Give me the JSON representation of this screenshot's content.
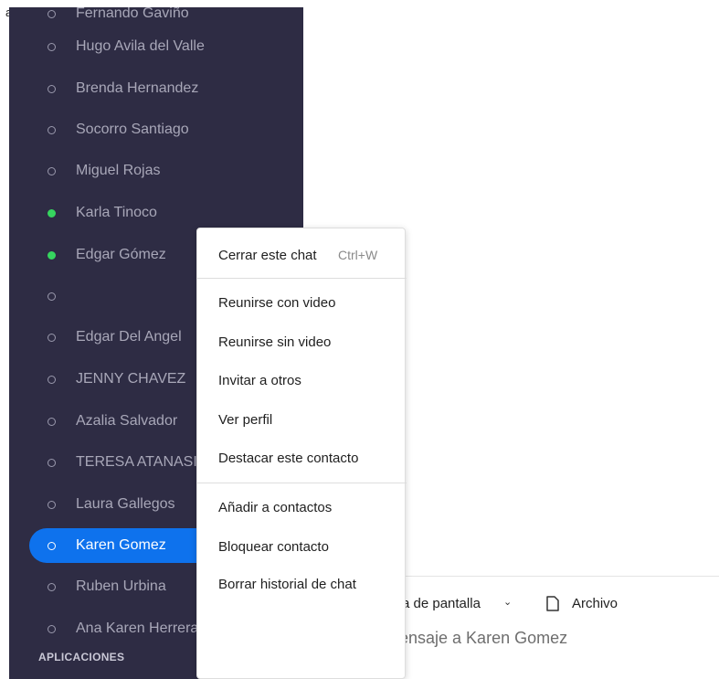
{
  "corner_letter": "a",
  "contacts": [
    {
      "name": "Fernando Gaviño",
      "status": "offline"
    },
    {
      "name": "Hugo Avila del Valle",
      "status": "offline"
    },
    {
      "name": "Brenda Hernandez",
      "status": "offline"
    },
    {
      "name": "Socorro Santiago",
      "status": "offline"
    },
    {
      "name": "Miguel Rojas",
      "status": "offline"
    },
    {
      "name": "Karla Tinoco",
      "status": "online"
    },
    {
      "name": "Edgar Gómez",
      "status": "online"
    },
    {
      "name": "",
      "status": "offline"
    },
    {
      "name": "Edgar Del Angel",
      "status": "offline"
    },
    {
      "name": "JENNY CHAVEZ",
      "status": "offline"
    },
    {
      "name": "Azalia Salvador",
      "status": "offline"
    },
    {
      "name": "TERESA ATANASIO",
      "status": "offline"
    },
    {
      "name": "Laura Gallegos",
      "status": "offline"
    },
    {
      "name": "Karen Gomez",
      "status": "offline",
      "selected": true
    },
    {
      "name": "Ruben Urbina",
      "status": "offline"
    },
    {
      "name": "Ana Karen Herrera",
      "status": "offline"
    }
  ],
  "sidebar_section": "APLICACIONES",
  "context_menu": {
    "close_chat": "Cerrar este chat",
    "close_chat_shortcut": "Ctrl+W",
    "meet_video": "Reunirse con video",
    "meet_no_video": "Reunirse sin video",
    "invite_others": "Invitar a otros",
    "view_profile": "Ver perfil",
    "star_contact": "Destacar este contacto",
    "add_contacts": "Añadir a contactos",
    "block_contact": "Bloquear contacto",
    "clear_history": "Borrar historial de chat"
  },
  "composer": {
    "screenshot_label": "a de pantalla",
    "file_label": "Archivo",
    "placeholder": "ıensaje a Karen Gomez"
  },
  "colors": {
    "sidebar_bg": "#2e2c44",
    "selected_bg": "#0e72ed",
    "online_dot": "#36d55f"
  },
  "icons": [
    "status-dot-icon",
    "chevron-down-icon",
    "file-icon"
  ]
}
